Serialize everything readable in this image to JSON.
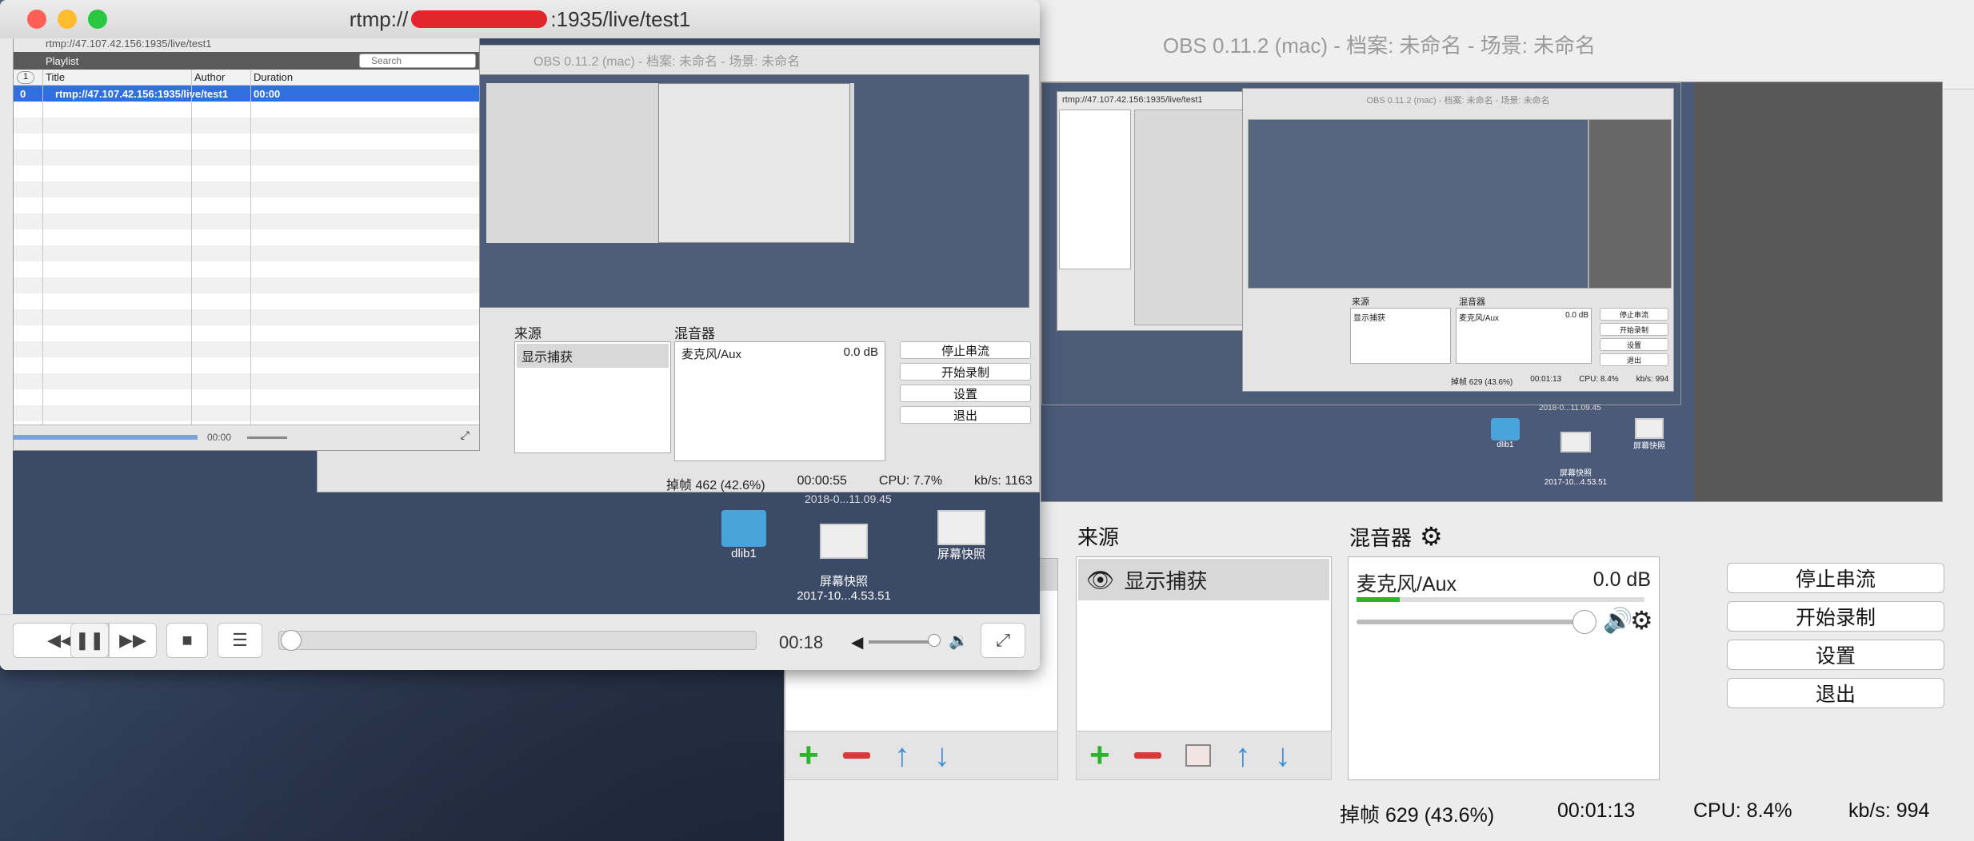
{
  "obs": {
    "title": "OBS 0.11.2 (mac) - 档案: 未命名 - 场景: 未命名",
    "sources_label": "来源",
    "mixer_label": "混音器",
    "source_item": "显示捕获",
    "mixer_channel": "麦克风/Aux",
    "mixer_db": "0.0 dB",
    "buttons": {
      "stop_stream": "停止串流",
      "start_record": "开始录制",
      "settings": "设置",
      "exit": "退出"
    },
    "status": {
      "dropped": "掉帧 629 (43.6%)",
      "time": "00:01:13",
      "cpu": "CPU: 8.4%",
      "kbs": "kb/s: 994"
    },
    "nested_status": {
      "dropped": "掉帧 629 (43.6%)",
      "time": "00:01:13",
      "cpu": "CPU: 8.4%",
      "kbs": "kb/s: 994"
    },
    "nested_buttons": [
      "停止串流",
      "开始录制",
      "设置",
      "退出"
    ],
    "nested_source": "显示捕获",
    "nested_mixer": "麦克风/Aux",
    "nested_db": "0.0 dB",
    "nested_mixer_label": "混音器",
    "nested_sources_label": "来源",
    "nested_vlc_title": "rtmp://47.107.42.156:1935/live/test1",
    "nested_obs_title": "OBS 0.11.2 (mac) - 档案: 未命名 - 场景: 未命名",
    "desktop_icons": [
      {
        "label": "dlib1"
      },
      {
        "label": "屏幕快照\n2017-10...4.53.51"
      },
      {
        "label": "屏幕快照"
      }
    ],
    "desk_top_label": "2018-0...11.09.45"
  },
  "vlc": {
    "title": "rtmp://47.1 ... 1935/live/test1",
    "title_visible": ":1935/live/test1",
    "title_prefix": "rtmp://",
    "time": "00:18",
    "progress": 0.0,
    "playlist": {
      "url_header": "rtmp://47.107.42.156:1935/live/test1",
      "label": "Playlist",
      "search_placeholder": "Search",
      "columns": [
        "Title",
        "Author",
        "Duration"
      ],
      "rows": [
        {
          "index": "0",
          "title": "rtmp://47.107.42.156:1935/live/test1",
          "author": "",
          "duration": "00:00"
        }
      ],
      "count_badge": "1",
      "time": "00:00"
    },
    "inner_obs": {
      "title": "OBS 0.11.2 (mac) - 档案: 未命名 - 场景: 未命名",
      "sources_label": "来源",
      "mixer_label": "混音器",
      "source_item": "显示捕获",
      "mixer_channel": "麦克风/Aux",
      "mixer_db": "0.0 dB",
      "buttons": [
        "停止串流",
        "开始录制",
        "设置",
        "退出"
      ],
      "status": {
        "dropped": "掉帧 462 (42.6%)",
        "time": "00:00:55",
        "cpu": "CPU: 7.7%",
        "kbs": "kb/s: 1163"
      }
    },
    "desktop_icons": [
      {
        "label": "dlib1"
      },
      {
        "label": "屏幕快照\n2017-10...4.53.51"
      },
      {
        "label": "屏幕快照"
      }
    ],
    "desk_top_label": "2018-0...11.09.45"
  },
  "colors": {
    "accent": "#2f6fe0",
    "plus": "#2db42d",
    "minus": "#d83a3a",
    "arrow": "#3a8fe0"
  }
}
